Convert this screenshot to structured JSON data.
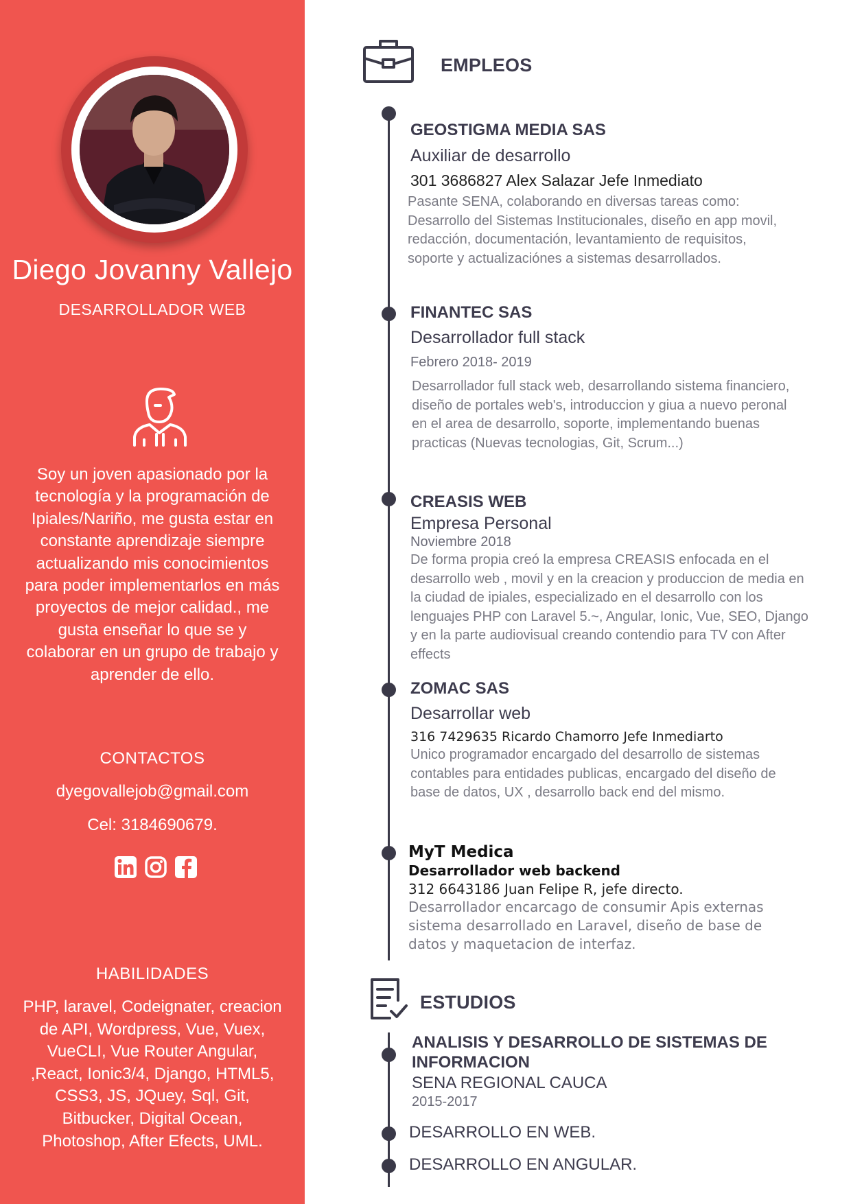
{
  "profile": {
    "name": "Diego Jovanny Vallejo",
    "role": "DESARROLLADOR  WEB",
    "bio": "Soy un joven apasionado por la tecnología y la programación de Ipiales/Nariño, me gusta estar en constante aprendizaje siempre actualizando mis conocimientos para poder implementarlos en más proyectos de mejor calidad., me gusta enseñar lo que se y colaborar en un grupo de trabajo y aprender de ello."
  },
  "contacts": {
    "title": "CONTACTOS",
    "email": "dyegovallejob@gmail.com",
    "phone": "Cel: 3184690679.",
    "social_icons": [
      "linkedin-icon",
      "instagram-icon",
      "facebook-icon"
    ]
  },
  "skills": {
    "title": "HABILIDADES",
    "text": "PHP, laravel, Codeignater, creacion de API, Wordpress, Vue, Vuex, VueCLI, Vue Router Angular, ,React, Ionic3/4, Django, HTML5, CSS3, JS, JQuey, Sql, Git, Bitbucker, Digital Ocean, Photoshop, After Efects, UML."
  },
  "employment": {
    "title": "EMPLEOS",
    "jobs": [
      {
        "company": "GEOSTIGMA MEDIA SAS",
        "position": "Auxiliar de desarrollo",
        "contact": "301 3686827  Alex Salazar Jefe Inmediato",
        "description": "Pasante SENA, colaborando en diversas tareas como: Desarrollo del Sistemas Institucionales,  diseño en app movil, redacción, documentación, levantamiento de requisitos, soporte y actualizaciónes a sistemas desarrollados."
      },
      {
        "company": "FINANTEC SAS",
        "position": "Desarrollador full stack",
        "period": "Febrero 2018- 2019",
        "description": "Desarrollador full stack web, desarrollando sistema financiero, diseño de portales web's, introduccion y giua a nuevo peronal en el area de desarrollo, soporte, implementando buenas practicas (Nuevas tecnologias, Git, Scrum...)"
      },
      {
        "company": "CREASIS WEB",
        "position": "Empresa Personal",
        "period": "Noviembre 2018",
        "description": "De forma propia creó la empresa CREASIS enfocada en el desarrollo web , movil y en la creacion y produccion de media en la ciudad de ipiales, especializado en el desarrollo con los lenguajes PHP con Laravel 5.~, Angular, Ionic, Vue, SEO, Django y en la parte audiovisual creando contendio para TV con After effects"
      },
      {
        "company": "ZOMAC SAS",
        "position": "Desarrollar web",
        "contact": "316 7429635 Ricardo Chamorro Jefe Inmediarto",
        "description": "Unico programador encargado del desarrollo de sistemas contables para entidades publicas, encargado del diseño de base de datos, UX , desarrollo back end del mismo."
      },
      {
        "company": "MyT Medica",
        "position": "Desarrollador web backend",
        "contact": "312 6643186 Juan Felipe R, jefe directo.",
        "description": "Desarrollador encarcago de consumir Apis externas sistema desarrollado en Laravel, diseño de base de datos y maquetacion de interfaz."
      }
    ]
  },
  "education": {
    "title": "ESTUDIOS",
    "degree": "ANALISIS Y DESARROLLO DE SISTEMAS  DE INFORMACION",
    "institution": "SENA REGIONAL CAUCA",
    "period": "2015-2017",
    "courses": [
      "DESARROLLO EN WEB.",
      "DESARROLLO EN ANGULAR."
    ]
  },
  "colors": {
    "sidebar": "#f0554f",
    "timeline": "#3a3948",
    "text_dark": "#3d3b4d",
    "text_muted": "#7a7a84"
  }
}
